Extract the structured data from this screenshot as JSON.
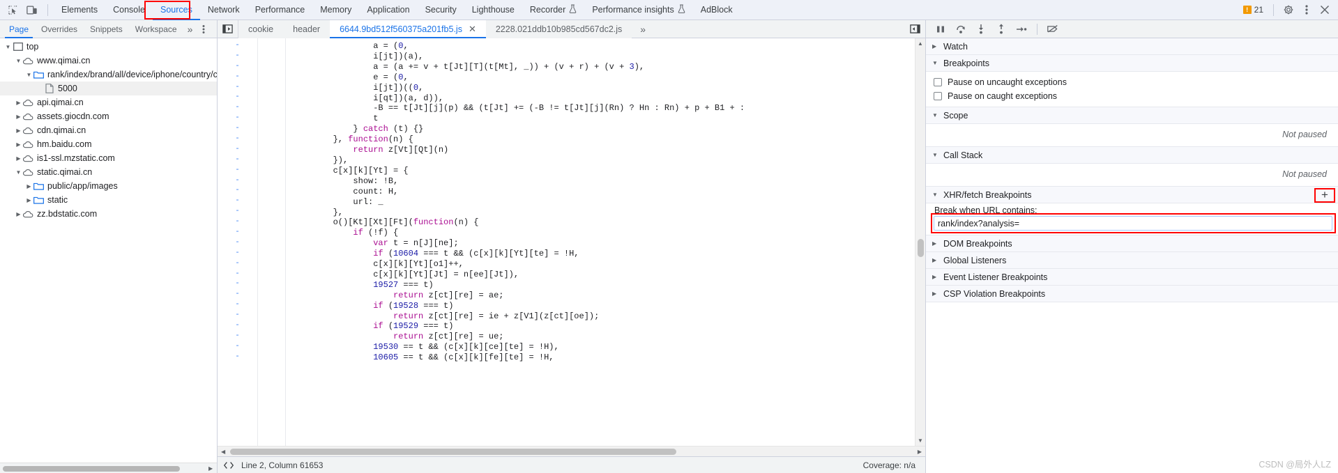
{
  "main_tabs": [
    {
      "label": "Elements",
      "selected": false,
      "flask": false
    },
    {
      "label": "Console",
      "selected": false,
      "flask": false
    },
    {
      "label": "Sources",
      "selected": true,
      "flask": false
    },
    {
      "label": "Network",
      "selected": false,
      "flask": false
    },
    {
      "label": "Performance",
      "selected": false,
      "flask": false
    },
    {
      "label": "Memory",
      "selected": false,
      "flask": false
    },
    {
      "label": "Application",
      "selected": false,
      "flask": false
    },
    {
      "label": "Security",
      "selected": false,
      "flask": false
    },
    {
      "label": "Lighthouse",
      "selected": false,
      "flask": false
    },
    {
      "label": "Recorder",
      "selected": false,
      "flask": true
    },
    {
      "label": "Performance insights",
      "selected": false,
      "flask": true
    },
    {
      "label": "AdBlock",
      "selected": false,
      "flask": false
    }
  ],
  "top_right": {
    "warning_count": "21",
    "warning_icon": "warning-triangle-icon",
    "settings_icon": "gear-icon",
    "more_icon": "kebab-menu-icon",
    "close_icon": "close-icon"
  },
  "top_left_icons": {
    "inspect_icon": "inspect-element-icon",
    "device_icon": "device-toolbar-icon"
  },
  "navigator": {
    "tabs": [
      {
        "label": "Page",
        "selected": true
      },
      {
        "label": "Overrides",
        "selected": false
      },
      {
        "label": "Snippets",
        "selected": false
      },
      {
        "label": "Workspace",
        "selected": false
      }
    ],
    "more_label": "»",
    "kebab_icon": "kebab-menu-icon",
    "tree": [
      {
        "label": "top",
        "depth": 0,
        "icon": "frame-icon",
        "twist": "open",
        "selected": false
      },
      {
        "label": "www.qimai.cn",
        "depth": 1,
        "icon": "cloud-icon",
        "twist": "open",
        "selected": false
      },
      {
        "label": "rank/index/brand/all/device/iphone/country/c",
        "depth": 2,
        "icon": "folder-icon-blue",
        "twist": "open",
        "selected": false
      },
      {
        "label": "5000",
        "depth": 3,
        "icon": "document-icon",
        "twist": "none",
        "selected": true
      },
      {
        "label": "api.qimai.cn",
        "depth": 1,
        "icon": "cloud-icon",
        "twist": "closed",
        "selected": false
      },
      {
        "label": "assets.giocdn.com",
        "depth": 1,
        "icon": "cloud-icon",
        "twist": "closed",
        "selected": false
      },
      {
        "label": "cdn.qimai.cn",
        "depth": 1,
        "icon": "cloud-icon",
        "twist": "closed",
        "selected": false
      },
      {
        "label": "hm.baidu.com",
        "depth": 1,
        "icon": "cloud-icon",
        "twist": "closed",
        "selected": false
      },
      {
        "label": "is1-ssl.mzstatic.com",
        "depth": 1,
        "icon": "cloud-icon",
        "twist": "closed",
        "selected": false
      },
      {
        "label": "static.qimai.cn",
        "depth": 1,
        "icon": "cloud-icon",
        "twist": "open",
        "selected": false
      },
      {
        "label": "public/app/images",
        "depth": 2,
        "icon": "folder-icon-blue",
        "twist": "closed",
        "selected": false
      },
      {
        "label": "static",
        "depth": 2,
        "icon": "folder-icon-blue",
        "twist": "closed",
        "selected": false
      },
      {
        "label": "zz.bdstatic.com",
        "depth": 1,
        "icon": "cloud-icon",
        "twist": "closed",
        "selected": false
      }
    ]
  },
  "editor": {
    "panel_toggle_icon": "show-navigator-icon",
    "file_tabs": [
      {
        "label": "cookie",
        "active": false,
        "closable": false
      },
      {
        "label": "header",
        "active": false,
        "closable": false
      },
      {
        "label": "6644.9bd512f560375a201fb5.js",
        "active": true,
        "closable": true
      },
      {
        "label": "2228.021ddb10b985cd567dc2.js",
        "active": false,
        "closable": false
      }
    ],
    "more_label": "»",
    "right_button_icon": "show-debugger-sidebar-icon",
    "close_glyph": "✕",
    "gutter_dash": "-",
    "code": "                a = (0,\n                i[jt])(a),\n                a = (a += v + t[Jt][T](t[Mt], _)) + (v + r) + (v + 3),\n                e = (0,\n                i[jt])((0,\n                i[qt])(a, d)),\n                -B == t[Jt][j](p) && (t[Jt] += (-B != t[Jt][j](Rn) ? Hn : Rn) + p + B1 + :\n                t\n            } catch (t) {}\n        }, function(n) {\n            return z[Vt][Qt](n)\n        }),\n        c[x][k][Yt] = {\n            show: !B,\n            count: H,\n            url: _\n        },\n        o()[Kt][Xt][Ft](function(n) {\n            if (!f) {\n                var t = n[J][ne];\n                if (10604 === t && (c[x][k][Yt][te] = !H,\n                c[x][k][Yt][o1]++,\n                c[x][k][Yt][Jt] = n[ee][Jt]),\n                19527 === t)\n                    return z[ct][re] = ae;\n                if (19528 === t)\n                    return z[ct][re] = ie + z[V1](z[ct][oe]);\n                if (19529 === t)\n                    return z[ct][re] = ue;\n                19530 == t && (c[x][k][ce][te] = !H),\n                10605 == t && (c[x][k][fe][te] = !H,",
    "line_count": 31,
    "status": {
      "format_icon": "pretty-print-icon",
      "position": "Line 2, Column 61653",
      "coverage": "Coverage: n/a"
    }
  },
  "debugger": {
    "toolbar": [
      {
        "icon": "pause-resume-icon",
        "name": "pause-script-execution"
      },
      {
        "icon": "step-over-icon",
        "name": "step-over-next-function-call"
      },
      {
        "icon": "step-into-icon",
        "name": "step-into-next-function-call"
      },
      {
        "icon": "step-out-icon",
        "name": "step-out-of-current-function"
      },
      {
        "icon": "step-icon",
        "name": "step"
      },
      {
        "icon": "deactivate-breakpoints-icon",
        "name": "deactivate-breakpoints"
      }
    ],
    "sections": [
      {
        "label": "Watch",
        "open": false
      },
      {
        "label": "Breakpoints",
        "open": true
      },
      {
        "label": "Scope",
        "open": true
      },
      {
        "label": "Call Stack",
        "open": true
      },
      {
        "label": "XHR/fetch Breakpoints",
        "open": true
      },
      {
        "label": "DOM Breakpoints",
        "open": false
      },
      {
        "label": "Global Listeners",
        "open": false
      },
      {
        "label": "Event Listener Breakpoints",
        "open": false
      },
      {
        "label": "CSP Violation Breakpoints",
        "open": false
      }
    ],
    "pause_options": [
      {
        "label": "Pause on uncaught exceptions",
        "checked": false
      },
      {
        "label": "Pause on caught exceptions",
        "checked": false
      }
    ],
    "scope_empty": "Not paused",
    "callstack_empty": "Not paused",
    "xhr": {
      "add_label": "+",
      "hint": "Break when URL contains:",
      "value": "rank/index?analysis=",
      "placeholder": "Break when URL contains:"
    }
  },
  "watermark": "CSDN @局外人LZ",
  "colors": {
    "accent": "#1a73e8",
    "highlight_box": "#ff0000",
    "toolbar_bg": "#f1f3f4",
    "tabbar_bg": "#eef1f8",
    "warning": "#f29900"
  }
}
